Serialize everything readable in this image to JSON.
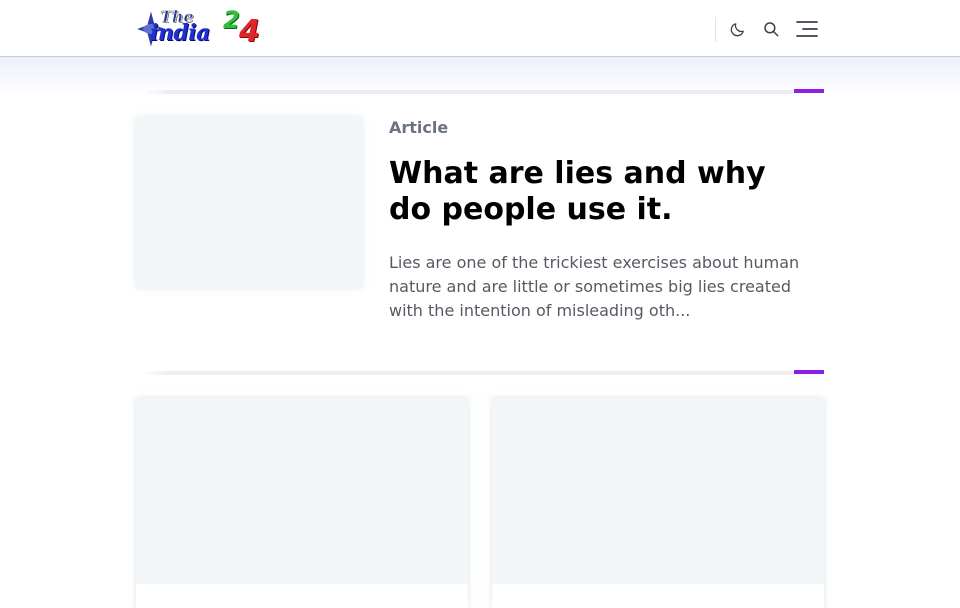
{
  "header": {
    "logo": {
      "the": "The",
      "india": "india",
      "two": "2",
      "four": "4"
    },
    "icons": {
      "theme": "moon-icon",
      "search": "search-icon",
      "menu": "menu-icon"
    }
  },
  "colors": {
    "accent": "#8a1fe8",
    "category": "#6b7280",
    "title": "#000000",
    "excerpt": "#555a62",
    "placeholder": "#f3f6f9"
  },
  "featured": {
    "category": "Article",
    "title": "What are lies and why do people use it.",
    "excerpt": "Lies are one of the trickiest exercises about human nature and are little or sometimes big lies created with the intention of misleading oth..."
  }
}
